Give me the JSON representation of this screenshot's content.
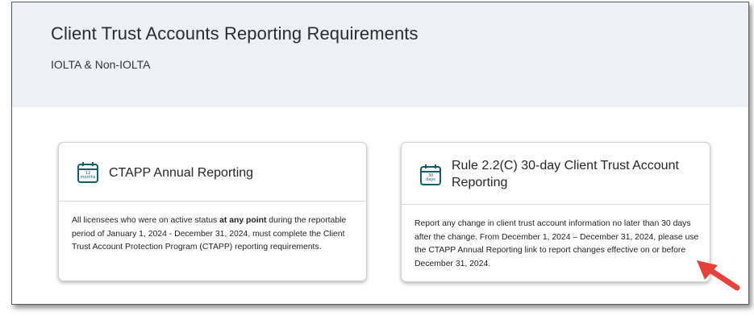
{
  "header": {
    "title": "Client Trust Accounts Reporting Requirements",
    "subtitle": "IOLTA & Non-IOLTA",
    "background": "#edf1f7"
  },
  "cards": [
    {
      "icon": "calendar-icon",
      "icon_line1": "12",
      "icon_line2": "months",
      "title": "CTAPP Annual Reporting",
      "body_before": "All licensees who were on active status ",
      "body_bold": "at any point",
      "body_after": " during the reportable period of January 1, 2024 - December 31, 2024, must complete the Client Trust Account Protection Program (CTAPP) reporting requirements."
    },
    {
      "icon": "calendar-icon",
      "icon_line1": "30",
      "icon_line2": "days",
      "title": "Rule 2.2(C) 30-day Client Trust Account Reporting",
      "body": "Report any change in client trust account information no later than 30 days after the change. From December 1, 2024 – December 31, 2024, please use the CTAPP Annual Reporting link to report changes effective on or before December 31, 2024."
    }
  ],
  "colors": {
    "icon": "#0e5e6f",
    "annotation_arrow": "#e8403a"
  },
  "annotation": {
    "icon": "red-pointer-arrow-icon"
  }
}
